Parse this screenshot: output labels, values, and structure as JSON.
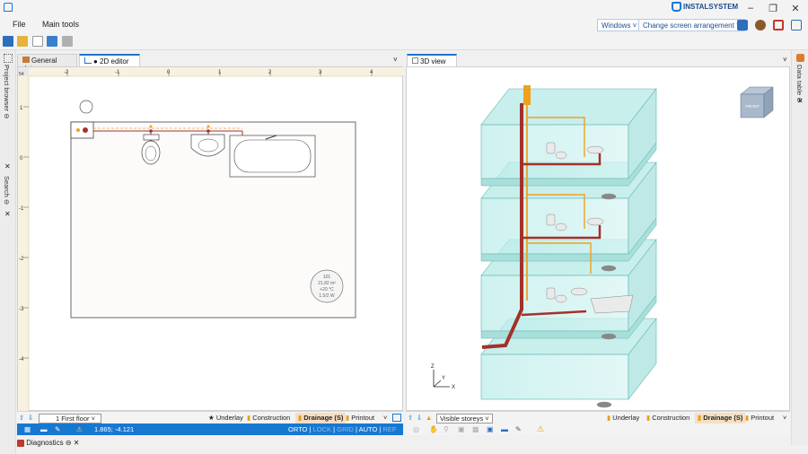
{
  "app": {
    "brand": "INSTALSYSTEM"
  },
  "menu": {
    "file": "File",
    "main_tools": "Main tools"
  },
  "top_buttons": {
    "windows": "Windows ˅",
    "arrangement": "Change screen arrangement ˅"
  },
  "side_panels": {
    "project_browser": "Project browser",
    "search": "Search",
    "data_table": "Data table"
  },
  "tabs": {
    "general": "General data",
    "editor2d": "● 2D editor",
    "view3d": "3D view",
    "close": "✕"
  },
  "ruler": {
    "corner": "54",
    "top_ticks": [
      "-2",
      "-1",
      "0",
      "1",
      "2",
      "3",
      "4"
    ],
    "left_ticks": [
      "1",
      "0",
      "-1",
      "-2",
      "-3",
      "-4"
    ]
  },
  "plan": {
    "room_number": "101",
    "room_area": "21.82 m²",
    "room_temp": "+20 °C",
    "room_power": "1.5/2 W"
  },
  "bottom2d": {
    "floor": "1 First floor",
    "underlay": "Underlay",
    "construction": "Construction",
    "drainage": "Drainage (S)",
    "printout": "Printout"
  },
  "status2d": {
    "coords": "1.865; -4.121",
    "orto": "ORTO",
    "lock": "LOCK",
    "grid": "GRID",
    "auto": "AUTO",
    "ref": "REF",
    "sep": "|"
  },
  "bottom3d": {
    "visible": "Visible storeys",
    "underlay": "Underlay",
    "construction": "Construction",
    "drainage": "Drainage (S)",
    "printout": "Printout"
  },
  "viewcube": {
    "face": "FRONT"
  },
  "axes": {
    "x": "X",
    "y": "Y",
    "z": "Z"
  },
  "diagnostics": {
    "label": "Diagnostics"
  },
  "colors": {
    "accent": "#1778d2",
    "drainage_pipe": "#a3312a",
    "water_pipe": "#f0a020",
    "glass": "#a8e3e0"
  }
}
